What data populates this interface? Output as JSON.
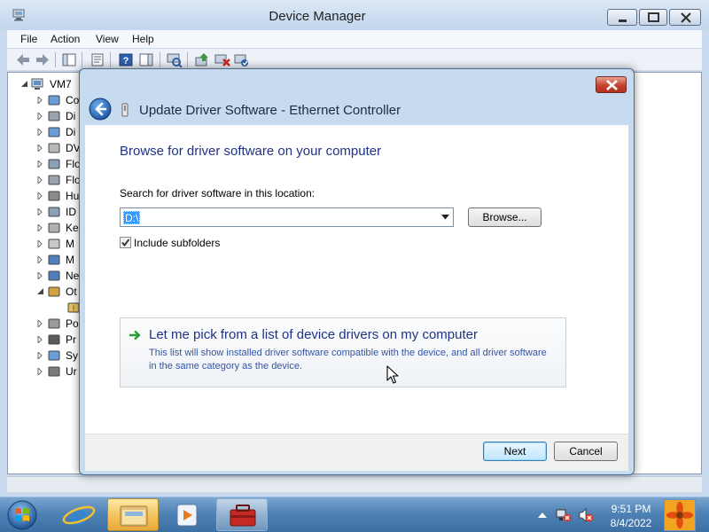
{
  "window": {
    "title": "Device Manager",
    "menu": [
      "File",
      "Action",
      "View",
      "Help"
    ]
  },
  "tree": {
    "root": "VM7",
    "categories": [
      {
        "label": "Co",
        "icon": "computer-icon"
      },
      {
        "label": "Di",
        "icon": "disk-drive-icon"
      },
      {
        "label": "Di",
        "icon": "display-adapter-icon"
      },
      {
        "label": "DV",
        "icon": "dvd-drive-icon"
      },
      {
        "label": "Flo",
        "icon": "floppy-controller-icon"
      },
      {
        "label": "Flo",
        "icon": "floppy-drive-icon"
      },
      {
        "label": "Hu",
        "icon": "hid-icon"
      },
      {
        "label": "ID",
        "icon": "ide-controller-icon"
      },
      {
        "label": "Ke",
        "icon": "keyboard-icon"
      },
      {
        "label": "M",
        "icon": "mouse-icon"
      },
      {
        "label": "M",
        "icon": "monitor-icon"
      },
      {
        "label": "Ne",
        "icon": "network-adapter-icon"
      },
      {
        "label": "Ot",
        "icon": "other-devices-icon"
      },
      {
        "label": "",
        "icon": "unknown-device-icon"
      },
      {
        "label": "Po",
        "icon": "port-icon"
      },
      {
        "label": "Pr",
        "icon": "processor-icon"
      },
      {
        "label": "Sy",
        "icon": "system-device-icon"
      },
      {
        "label": "Ur",
        "icon": "usb-controller-icon"
      }
    ]
  },
  "dialog": {
    "title": "Update Driver Software - Ethernet Controller",
    "heading": "Browse for driver software on your computer",
    "search_label": "Search for driver software in this location:",
    "path_value": "D:\\",
    "browse_label": "Browse...",
    "include_subfolders_label": "Include subfolders",
    "include_subfolders_checked": true,
    "pick_title": "Let me pick from a list of device drivers on my computer",
    "pick_description": "This list will show installed driver software compatible with the device, and all driver software in the same category as the device.",
    "next_label": "Next",
    "cancel_label": "Cancel"
  },
  "taskbar": {
    "time": "9:51 PM",
    "date": "8/4/2022"
  },
  "colors": {
    "link_blue": "#1e3287",
    "selection_blue": "#3399ff",
    "taskbar_blue": "#4f82b5"
  }
}
